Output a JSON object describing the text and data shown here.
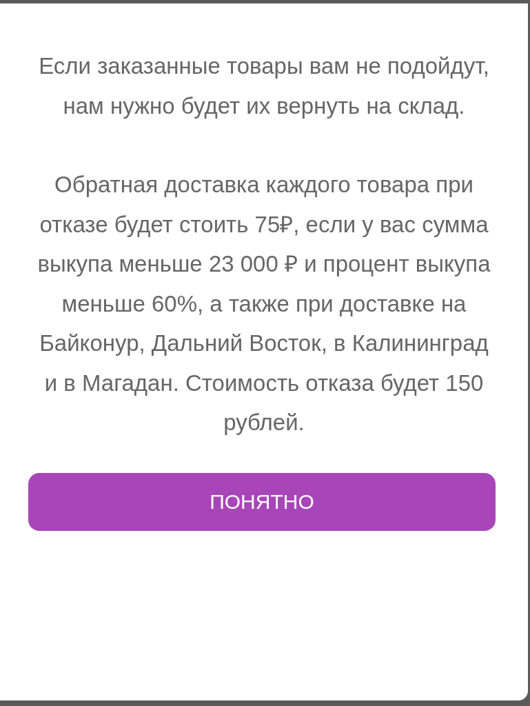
{
  "dialog": {
    "paragraphs": [
      "Если заказанные товары вам не подойдут, нам нужно будет их вернуть на склад.",
      "Обратная доставка каждого товара при отказе будет стоить 75₽, если у вас сумма выкупа меньше 23 000 ₽ и процент выкупа меньше 60%, а также при доставке на Байконур, Дальний Восток, в Калининград и в Магадан. Стоимость отказа будет 150 рублей."
    ],
    "button": "ПОНЯТНО"
  }
}
